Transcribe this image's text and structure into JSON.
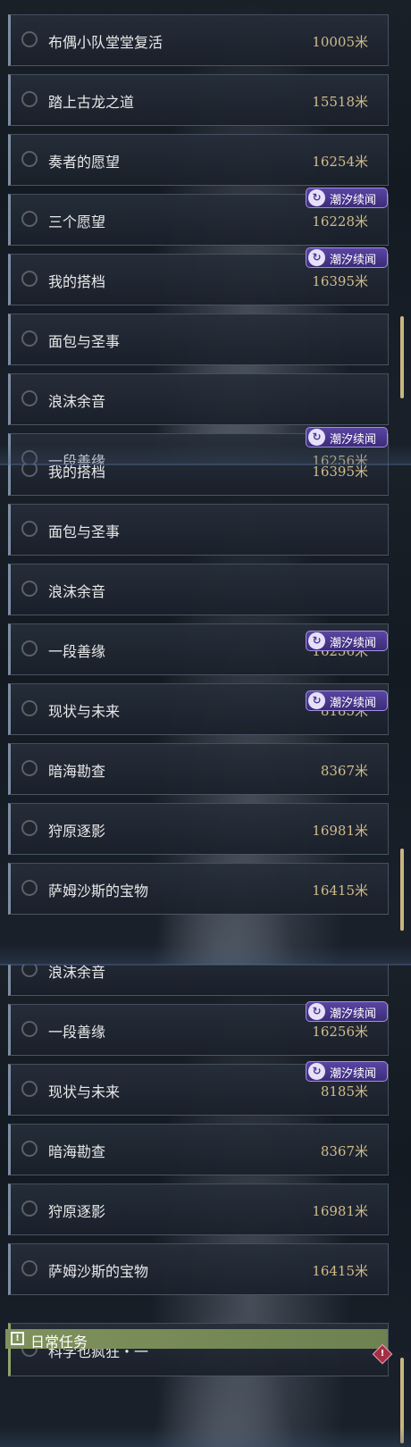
{
  "tag_label": "潮汐续闻",
  "unit": "米",
  "panel1": {
    "rows": [
      {
        "title": "布偶小队堂堂复活",
        "distance": "10005米"
      },
      {
        "title": "踏上古龙之道",
        "distance": "15518米"
      },
      {
        "title": "奏者的愿望",
        "distance": "16254米"
      },
      {
        "title": "三个愿望",
        "distance": "16228米"
      },
      {
        "title": "我的搭档",
        "distance": "16395米"
      },
      {
        "title": "面包与圣事",
        "distance": ""
      },
      {
        "title": "浪沫余音",
        "distance": ""
      },
      {
        "title": "一段善缘",
        "distance": "16256米"
      }
    ]
  },
  "panel2": {
    "rows": [
      {
        "title": "我的搭档",
        "distance": "16395米"
      },
      {
        "title": "面包与圣事",
        "distance": ""
      },
      {
        "title": "浪沫余音",
        "distance": ""
      },
      {
        "title": "一段善缘",
        "distance": "16256米"
      },
      {
        "title": "现状与未来",
        "distance": "8185米"
      },
      {
        "title": "暗海勘查",
        "distance": "8367米"
      },
      {
        "title": "狩原逐影",
        "distance": "16981米"
      },
      {
        "title": "萨姆沙斯的宝物",
        "distance": "16415米"
      }
    ]
  },
  "panel3": {
    "rows": [
      {
        "title": "浪沫余音",
        "distance": ""
      },
      {
        "title": "一段善缘",
        "distance": "16256米"
      },
      {
        "title": "现状与未来",
        "distance": "8185米"
      },
      {
        "title": "暗海勘查",
        "distance": "8367米"
      },
      {
        "title": "狩原逐影",
        "distance": "16981米"
      },
      {
        "title": "萨姆沙斯的宝物",
        "distance": "16415米"
      }
    ],
    "section": {
      "icon": "!",
      "title": "日常任务"
    },
    "daily_rows": [
      {
        "title": "科学也疯狂・一",
        "distance": ""
      }
    ]
  },
  "colors": {
    "accent_gold": "#d2bb8a",
    "tag_purple": "#4b3a92",
    "daily_green": "#7f925c",
    "alert_red": "#a52f45"
  },
  "icons": {
    "row_marker": "radio-circle-icon",
    "tag": "tidal-swirl-icon",
    "section": "exclamation-icon",
    "alert": "alert-diamond-icon"
  }
}
